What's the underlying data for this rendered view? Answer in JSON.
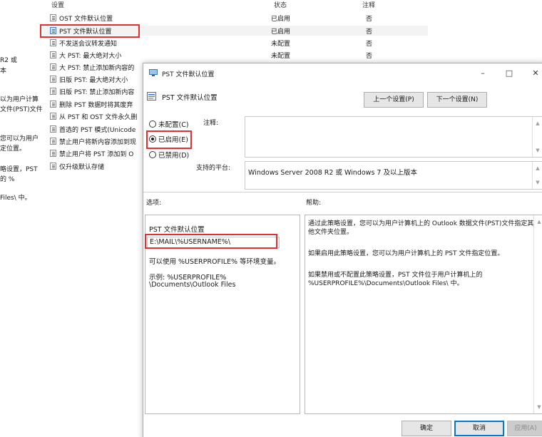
{
  "background": {
    "columns": {
      "setting": "设置",
      "state": "状态",
      "comment": "注释"
    },
    "rows": [
      {
        "name": "OST 文件默认位置",
        "state": "已启用",
        "comment": "否"
      },
      {
        "name": "PST 文件默认位置",
        "state": "已启用",
        "comment": "否"
      },
      {
        "name": "不发送会议转发通知",
        "state": "未配置",
        "comment": "否"
      },
      {
        "name": "大 PST: 最大绝对大小",
        "state": "未配置",
        "comment": "否"
      },
      {
        "name": "大 PST: 禁止添加新内容的",
        "state": "",
        "comment": ""
      },
      {
        "name": "旧版 PST: 最大绝对大小",
        "state": "",
        "comment": ""
      },
      {
        "name": "旧版 PST: 禁止添加新内容",
        "state": "",
        "comment": ""
      },
      {
        "name": "删除 PST 数据时将其废弃",
        "state": "",
        "comment": ""
      },
      {
        "name": "从 PST 和 OST 文件永久删",
        "state": "",
        "comment": ""
      },
      {
        "name": "首选的 PST 模式(Unicode",
        "state": "",
        "comment": ""
      },
      {
        "name": "禁止用户将新内容添加到现",
        "state": "",
        "comment": ""
      },
      {
        "name": "禁止用户将 PST 添加到 O",
        "state": "",
        "comment": ""
      },
      {
        "name": "仅升级默认存储",
        "state": "",
        "comment": ""
      }
    ],
    "left_fragments": [
      "R2 或",
      "本",
      "以为用户计算",
      "文件(PST)文件",
      "您可以为用户",
      "定位置。",
      "略设置，PST",
      "的 %",
      "Files\\ 中。"
    ]
  },
  "dialog": {
    "window_title": "PST 文件默认位置",
    "setting_title": "PST 文件默认位置",
    "prev_button": "上一个设置(P)",
    "next_button": "下一个设置(N)",
    "radio_not_configured": "未配置(C)",
    "radio_enabled": "已启用(E)",
    "radio_disabled": "已禁用(D)",
    "selected_state": "enabled",
    "comment_label": "注释:",
    "platform_label": "支持的平台:",
    "platform_value": "Windows Server 2008 R2 或 Windows 7 及以上版本",
    "options_label": "选项:",
    "help_label": "帮助:",
    "options": {
      "field_label": "PST 文件默认位置",
      "field_value": "E:\\MAIL\\%USERNAME%\\",
      "note1": "可以使用 %USERPROFILE% 等环境变量。",
      "note2_line1": "示例: %USERPROFILE%",
      "note2_line2": "\\Documents\\Outlook Files"
    },
    "help": {
      "p1": "通过此策略设置，您可以为用户计算机上的 Outlook 数据文件(PST)文件指定其他文件夹位置。",
      "p2": "如果启用此策略设置，您可以为用户计算机上的 PST 文件指定位置。",
      "p3": "如果禁用或不配置此策略设置，PST 文件位于用户计算机上的 %USERPROFILE%\\Documents\\Outlook Files\\ 中。"
    },
    "ok_button": "确定",
    "cancel_button": "取消",
    "apply_button": "应用(A)"
  },
  "colors": {
    "highlight": "#e03030",
    "accent": "#0078d7"
  }
}
